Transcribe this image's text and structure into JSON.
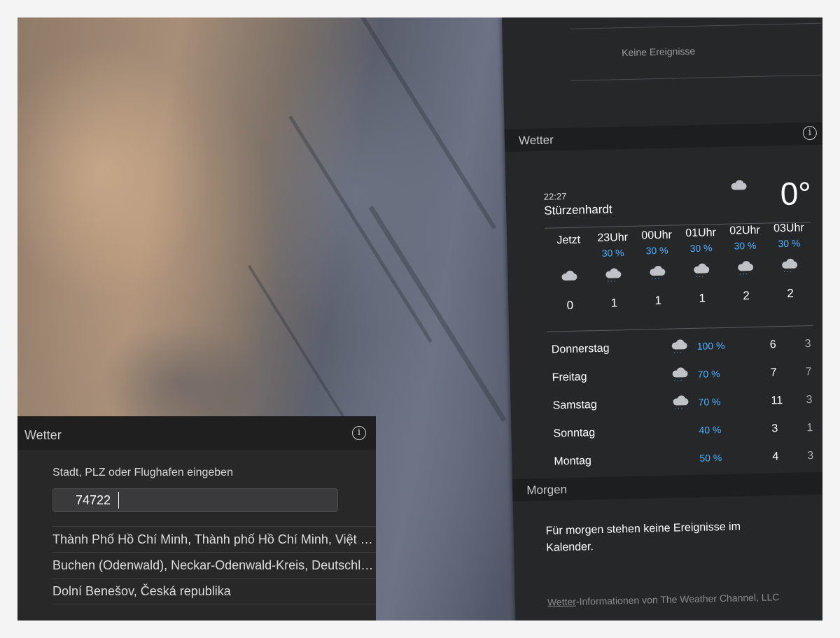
{
  "calendar": {
    "no_events": "Keine Ereignisse"
  },
  "weather": {
    "title": "Wetter",
    "info_icon": "info-icon",
    "time": "22:27",
    "city": "Stürzenhardt",
    "current_temp": "0°",
    "current_icon": "cloud-icon",
    "hourly": [
      {
        "hour": "Jetzt",
        "precip": "",
        "temp": "0",
        "icon": "cloud-icon"
      },
      {
        "hour": "23Uhr",
        "precip": "30 %",
        "temp": "1",
        "icon": "rain-icon"
      },
      {
        "hour": "00Uhr",
        "precip": "30 %",
        "temp": "1",
        "icon": "rain-icon"
      },
      {
        "hour": "01Uhr",
        "precip": "30 %",
        "temp": "1",
        "icon": "rain-icon"
      },
      {
        "hour": "02Uhr",
        "precip": "30 %",
        "temp": "2",
        "icon": "rain-icon"
      },
      {
        "hour": "03Uhr",
        "precip": "30 %",
        "temp": "2",
        "icon": "rain-icon"
      }
    ],
    "daily": [
      {
        "day": "Donnerstag",
        "precip": "100 %",
        "high": "6",
        "low": "3",
        "icon": "rain-icon"
      },
      {
        "day": "Freitag",
        "precip": "70 %",
        "high": "7",
        "low": "7",
        "icon": "rain-icon"
      },
      {
        "day": "Samstag",
        "precip": "70 %",
        "high": "11",
        "low": "3",
        "icon": "rain-icon"
      },
      {
        "day": "Sonntag",
        "precip": "40 %",
        "high": "3",
        "low": "1",
        "icon": ""
      },
      {
        "day": "Montag",
        "precip": "50 %",
        "high": "4",
        "low": "3",
        "icon": ""
      }
    ]
  },
  "tomorrow": {
    "title": "Morgen",
    "text": "Für morgen stehen keine Ereignisse im Kalender."
  },
  "credit": {
    "link": "Wetter",
    "text": "-Informationen von The Weather Channel, LLC"
  },
  "config": {
    "title": "Wetter",
    "prompt": "Stadt, PLZ oder Flughafen eingeben",
    "input_value": "74722",
    "results": [
      "Thành Phố Hồ Chí Minh, Thành phố Hồ Chí Minh, Việt Nam",
      "Buchen (Odenwald), Neckar-Odenwald-Kreis, Deutschland",
      "Dolní Benešov, Česká republika"
    ]
  }
}
